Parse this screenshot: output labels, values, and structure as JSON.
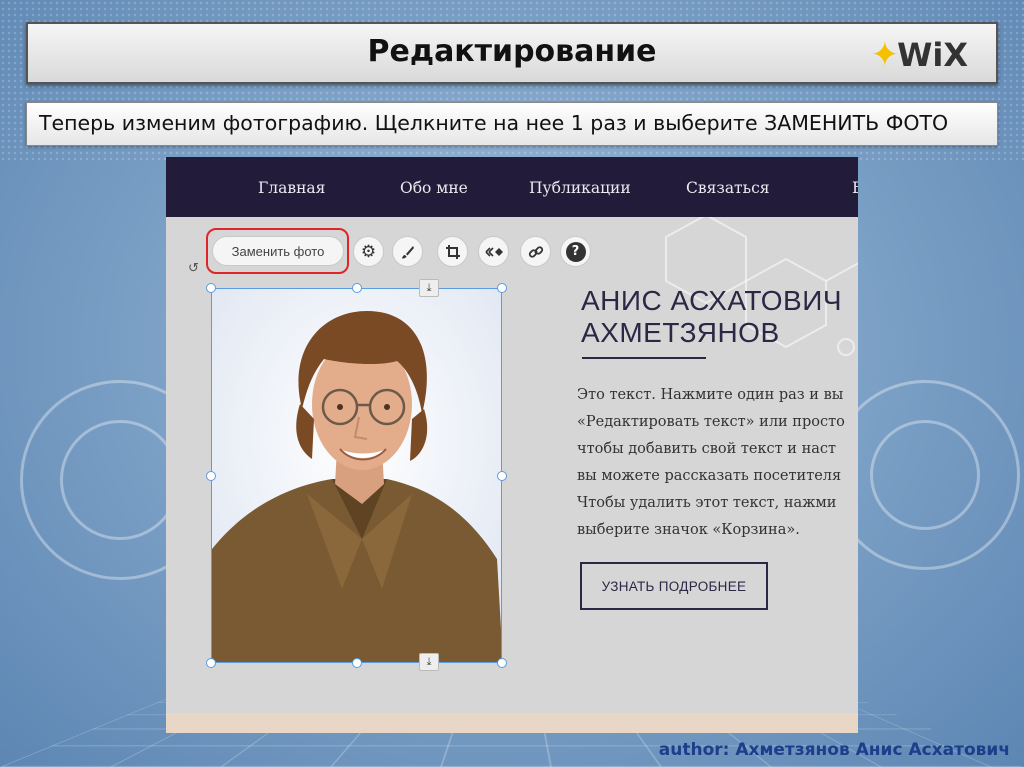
{
  "slide": {
    "title": "Редактирование",
    "logo_text": "WiX",
    "instruction": "Теперь изменим фотографию. Щелкните на нее 1 раз и выберите ЗАМЕНИТЬ ФОТО",
    "author": "author: Ахметзянов Анис Асхатович"
  },
  "site": {
    "nav": [
      "Главная",
      "Обо мне",
      "Публикации",
      "Связаться",
      "Б"
    ],
    "name_line1": "АНИС АСХАТОВИЧ",
    "name_line2": "АХМЕТЗЯНОВ",
    "body_lines": [
      "Это текст. Нажмите один раз и вы",
      "«Редактировать текст» или просто",
      "чтобы добавить свой текст и наст",
      "вы можете рассказать посетителя",
      "Чтобы удалить этот текст, нажми",
      "выберите значок «Корзина»."
    ],
    "learn_more": "УЗНАТЬ ПОДРОБНЕЕ"
  },
  "toolbar": {
    "replace_photo": "Заменить фото",
    "icons": [
      "gear-icon",
      "brush-icon",
      "crop-icon",
      "animation-icon",
      "link-icon",
      "help-icon"
    ]
  },
  "colors": {
    "nav_bg": "#221c3a",
    "accent_red": "#e0252a",
    "selection_blue": "#5b9be0",
    "heading_color": "#2a2844"
  }
}
